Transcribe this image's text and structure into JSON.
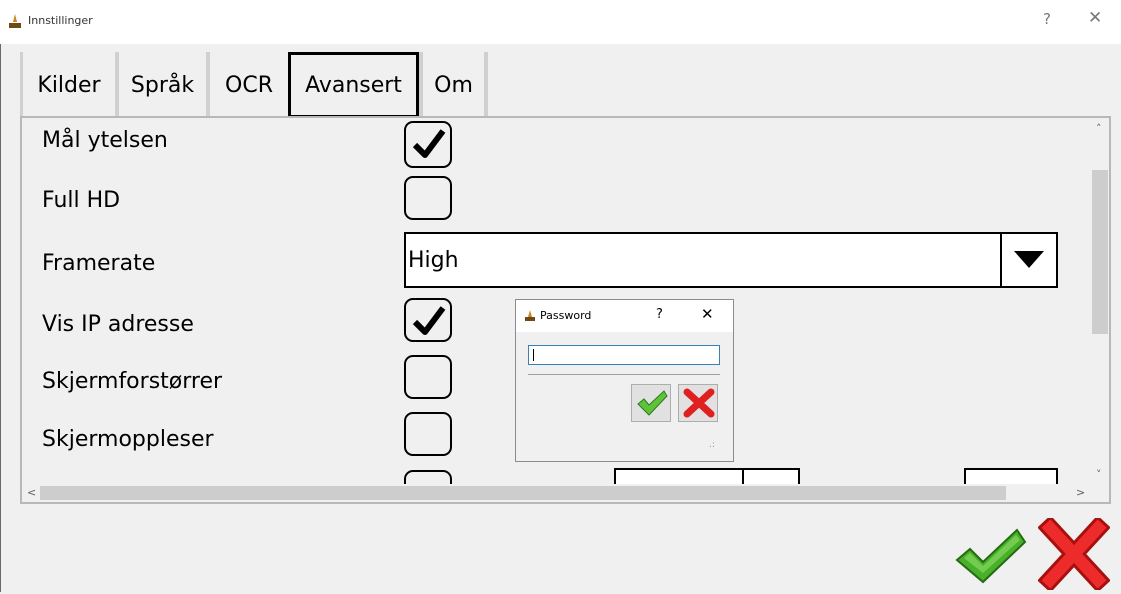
{
  "window": {
    "title": "Innstillinger",
    "help_label": "?",
    "close_label": "✕"
  },
  "tabs": [
    {
      "label": "Kilder",
      "active": false
    },
    {
      "label": "Språk",
      "active": false
    },
    {
      "label": "OCR",
      "active": false
    },
    {
      "label": "Avansert",
      "active": true
    },
    {
      "label": "Om",
      "active": false
    }
  ],
  "settings": {
    "measure_performance": {
      "label": "Mål ytelsen",
      "checked": true
    },
    "full_hd": {
      "label": "Full HD",
      "checked": false
    },
    "framerate": {
      "label": "Framerate",
      "value": "High"
    },
    "show_ip": {
      "label": "Vis IP adresse",
      "checked": true
    },
    "magnifier": {
      "label": "Skjermforstørrer",
      "checked": false
    },
    "screen_reader": {
      "label": "Skjermoppleser",
      "checked": false
    }
  },
  "scroll": {
    "up": "˄",
    "down": "˅",
    "left": "<",
    "right": ">"
  },
  "password_dialog": {
    "title": "Password",
    "help_label": "?",
    "close_label": "✕",
    "input_value": "",
    "grip": ".:"
  },
  "icons": {
    "app": "candle-icon",
    "ok": "checkmark-icon",
    "cancel": "red-x-icon"
  },
  "colors": {
    "ok_green": "#3fae25",
    "cancel_red": "#e02020"
  }
}
